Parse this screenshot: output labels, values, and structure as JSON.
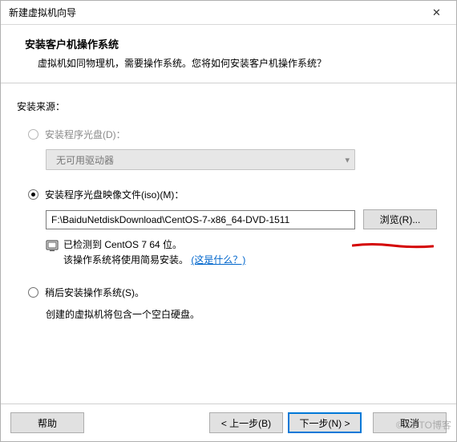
{
  "window": {
    "title": "新建虚拟机向导",
    "close_glyph": "✕"
  },
  "header": {
    "title": "安装客户机操作系统",
    "subtitle": "虚拟机如同物理机，需要操作系统。您将如何安装客户机操作系统？"
  },
  "source_label": "安装来源：",
  "options": {
    "disc": {
      "label": "安装程序光盘(D)：",
      "drive_placeholder": "无可用驱动器"
    },
    "iso": {
      "label": "安装程序光盘映像文件(iso)(M)：",
      "path": "F:\\BaiduNetdiskDownload\\CentOS-7-x86_64-DVD-1511",
      "browse": "浏览(R)...",
      "detected_line1": "已检测到 CentOS 7 64 位。",
      "detected_line2": "该操作系统将使用简易安装。",
      "whats_this": "(这是什么？)"
    },
    "later": {
      "label": "稍后安装操作系统(S)。",
      "note": "创建的虚拟机将包含一个空白硬盘。"
    }
  },
  "footer": {
    "help": "帮助",
    "back": "< 上一步(B)",
    "next": "下一步(N) >",
    "cancel": "取消"
  },
  "watermark": "© 51 TO博客"
}
